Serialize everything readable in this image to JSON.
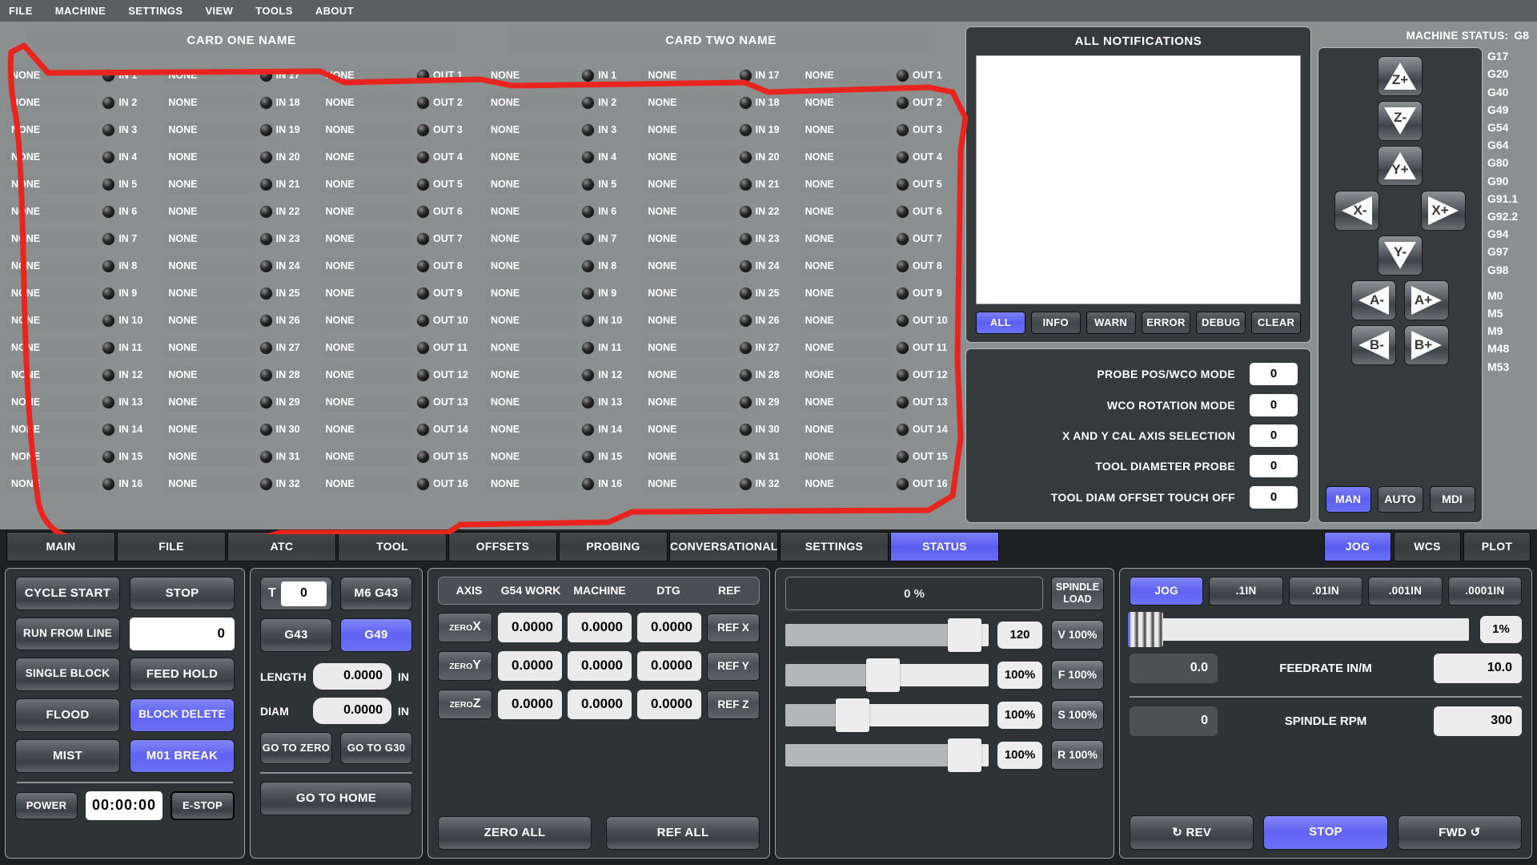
{
  "menubar": [
    "FILE",
    "MACHINE",
    "SETTINGS",
    "VIEW",
    "TOOLS",
    "ABOUT"
  ],
  "io": {
    "cards": [
      {
        "title": "CARD ONE NAME"
      },
      {
        "title": "CARD TWO NAME"
      }
    ],
    "default_name": "NONE",
    "columns": [
      {
        "prefix": "IN",
        "start": 1,
        "count": 16
      },
      {
        "prefix": "IN",
        "start": 17,
        "count": 16
      },
      {
        "prefix": "OUT",
        "start": 1,
        "count": 16
      }
    ]
  },
  "notifications": {
    "title": "ALL NOTIFICATIONS",
    "messages": [],
    "filters": [
      {
        "label": "ALL",
        "active": true
      },
      {
        "label": "INFO",
        "active": false
      },
      {
        "label": "WARN",
        "active": false
      },
      {
        "label": "ERROR",
        "active": false
      },
      {
        "label": "DEBUG",
        "active": false
      },
      {
        "label": "CLEAR",
        "active": false
      }
    ]
  },
  "probe_settings": [
    {
      "label": "PROBE POS/WCO MODE",
      "value": "0"
    },
    {
      "label": "WCO ROTATION MODE",
      "value": "0"
    },
    {
      "label": "X AND Y CAL AXIS SELECTION",
      "value": "0"
    },
    {
      "label": "TOOL DIAMETER PROBE",
      "value": "0"
    },
    {
      "label": "TOOL DIAM OFFSET TOUCH OFF",
      "value": "0"
    }
  ],
  "machine_status": {
    "label": "MACHINE STATUS:",
    "gcodes": [
      "G8",
      "G17",
      "G20",
      "G40",
      "G49",
      "G54",
      "G64",
      "G80",
      "G90",
      "G91.1",
      "G92.2",
      "G94",
      "G97",
      "G98"
    ],
    "mcodes": [
      "M0",
      "M5",
      "M9",
      "M48",
      "M53"
    ],
    "jog_buttons": [
      {
        "label": "Z+",
        "dir": "up"
      },
      {
        "label": "Z-",
        "dir": "down"
      },
      {
        "label": "Y+",
        "dir": "up"
      },
      {
        "label": "X-",
        "dir": "left"
      },
      {
        "label": "X+",
        "dir": "right"
      },
      {
        "label": "Y-",
        "dir": "down"
      },
      {
        "label": "A-",
        "dir": "left"
      },
      {
        "label": "A+",
        "dir": "right"
      },
      {
        "label": "B-",
        "dir": "left"
      },
      {
        "label": "B+",
        "dir": "right"
      }
    ],
    "modes": [
      {
        "label": "MAN",
        "active": true
      },
      {
        "label": "AUTO",
        "active": false
      },
      {
        "label": "MDI",
        "active": false
      }
    ]
  },
  "tabs": {
    "main": [
      {
        "label": "MAIN",
        "active": false
      },
      {
        "label": "FILE",
        "active": false
      },
      {
        "label": "ATC",
        "active": false
      },
      {
        "label": "TOOL",
        "active": false
      },
      {
        "label": "OFFSETS",
        "active": false
      },
      {
        "label": "PROBING",
        "active": false
      },
      {
        "label": "CONVERSATIONAL",
        "active": false
      },
      {
        "label": "SETTINGS",
        "active": false
      },
      {
        "label": "STATUS",
        "active": true
      }
    ],
    "right": [
      {
        "label": "JOG",
        "active": true
      },
      {
        "label": "WCS",
        "active": false
      },
      {
        "label": "PLOT",
        "active": false
      }
    ]
  },
  "control": {
    "cycle_start": "CYCLE START",
    "stop": "STOP",
    "run_from_line": "RUN FROM LINE",
    "run_from_line_value": "0",
    "single_block": "SINGLE BLOCK",
    "feed_hold": "FEED HOLD",
    "flood": "FLOOD",
    "block_delete": "BLOCK DELETE",
    "mist": "MIST",
    "m01_break": "M01 BREAK",
    "power": "POWER",
    "timer": "00:00:00",
    "estop": "E-STOP"
  },
  "tool": {
    "t_label": "T",
    "t_value": "0",
    "m6g43": "M6 G43",
    "g43": "G43",
    "g49": "G49",
    "length_label": "LENGTH",
    "length_value": "0.0000",
    "length_unit": "IN",
    "diam_label": "DIAM",
    "diam_value": "0.0000",
    "diam_unit": "IN",
    "go_to_zero": "GO TO ZERO",
    "go_to_g30": "GO TO G30",
    "go_to_home": "GO TO HOME"
  },
  "dro": {
    "headers": [
      "AXIS",
      "G54 WORK",
      "MACHINE",
      "DTG",
      "REF"
    ],
    "zero_prefix": "ZERO",
    "rows": [
      {
        "axis": "X",
        "work": "0.0000",
        "machine": "0.0000",
        "dtg": "0.0000",
        "ref": "REF X"
      },
      {
        "axis": "Y",
        "work": "0.0000",
        "machine": "0.0000",
        "dtg": "0.0000",
        "ref": "REF Y"
      },
      {
        "axis": "Z",
        "work": "0.0000",
        "machine": "0.0000",
        "dtg": "0.0000",
        "ref": "REF Z"
      }
    ],
    "zero_all": "ZERO ALL",
    "ref_all": "REF ALL"
  },
  "overrides": {
    "load_percent": "0 %",
    "spindle_load": "SPINDLE LOAD",
    "sliders": [
      {
        "value": "120",
        "button": "V 100%",
        "pos": 83
      },
      {
        "value": "100%",
        "button": "F 100%",
        "pos": 43
      },
      {
        "value": "100%",
        "button": "S 100%",
        "pos": 28
      },
      {
        "value": "100%",
        "button": "R 100%",
        "pos": 83
      }
    ]
  },
  "jogpanel": {
    "increments": [
      {
        "label": "JOG",
        "active": true
      },
      {
        "label": ".1IN",
        "active": false
      },
      {
        "label": ".01IN",
        "active": false
      },
      {
        "label": ".001IN",
        "active": false
      },
      {
        "label": ".0001IN",
        "active": false
      }
    ],
    "jog_percent": "1%",
    "feedrate_actual": "0.0",
    "feedrate_label": "FEEDRATE IN/M",
    "feedrate_target": "10.0",
    "rpm_actual": "0",
    "rpm_label": "SPINDLE RPM",
    "rpm_target": "300",
    "rev": "REV",
    "spindle_stop": "STOP",
    "fwd": "FWD"
  },
  "colors": {
    "accent_blue": "#6a6ef0",
    "panel_dark": "#353a3d",
    "background": "#8c8f90",
    "annotation_red": "#e8241f"
  }
}
